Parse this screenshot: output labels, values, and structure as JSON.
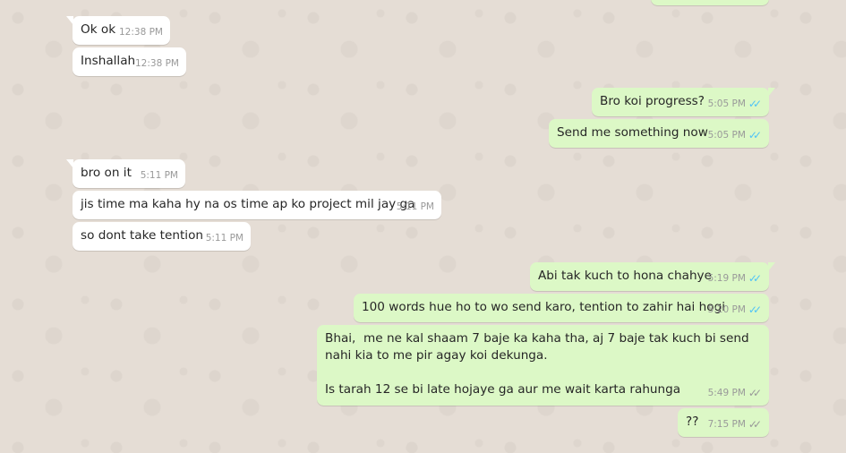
{
  "messages": [
    {
      "text": "Ok ok",
      "time": "12:38 PM"
    },
    {
      "text": "Inshallah",
      "time": "12:38 PM"
    },
    {
      "text": "Bro koi progress?",
      "time": "5:05 PM",
      "tick": "✓✓"
    },
    {
      "text": "Send me something now",
      "time": "5:05 PM",
      "tick": "✓✓"
    },
    {
      "text": "bro on it",
      "time": "5:11 PM"
    },
    {
      "text": "jis time ma kaha hy na os time ap ko project mil jay ga",
      "time": "5:11 PM"
    },
    {
      "text": "so dont take tention",
      "time": "5:11 PM"
    },
    {
      "text": "Abi tak kuch to hona chahye",
      "time": "5:19 PM",
      "tick": "✓✓"
    },
    {
      "text": "100 words hue ho to wo send karo, tention to zahir hai hogi",
      "time": "5:20 PM",
      "tick": "✓✓"
    },
    {
      "text": "Bhai,  me ne kal shaam 7 baje ka kaha tha, aj 7 baje tak kuch bi send nahi kia to me pir agay koi dekunga.\n\nIs tarah 12 se bi late hojaye ga aur me wait karta rahunga",
      "time": "5:49 PM",
      "tick": "✓✓"
    },
    {
      "text": "??",
      "time": "7:15 PM",
      "tick": "✓✓"
    }
  ],
  "colors": {
    "wallpaper": "#e5ddd5",
    "incoming_bubble": "#ffffff",
    "outgoing_bubble": "#dcf8c6",
    "read_tick": "#4fc3f7",
    "delivered_tick": "#999999"
  }
}
